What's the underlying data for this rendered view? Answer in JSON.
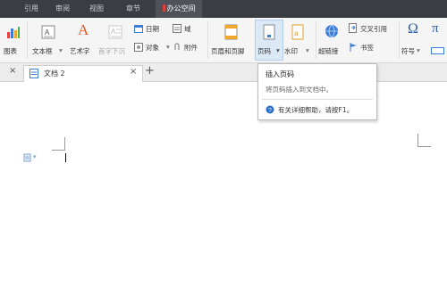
{
  "menubar": {
    "items": [
      {
        "label": "引用"
      },
      {
        "label": "审阅"
      },
      {
        "label": "视图"
      },
      {
        "label": "章节"
      },
      {
        "label": "办公空间"
      }
    ]
  },
  "ribbon": {
    "chart_label": "图表",
    "textbox_label": "文本框",
    "wordart_label": "艺术字",
    "dropcap_label": "首字下沉",
    "date_label": "日期",
    "field_label": "域",
    "object_label": "对象",
    "attachment_label": "附件",
    "header_footer_label": "页眉和页脚",
    "page_number_label": "页码",
    "watermark_label": "水印",
    "hyperlink_label": "超链接",
    "cross_ref_label": "交叉引用",
    "bookmark_label": "书签",
    "symbol_label": "符号",
    "dropdown_arrow": "▾",
    "pi_glyph": "π"
  },
  "tabbar": {
    "close_glyph": "×",
    "doc_tab_label": "文档 2",
    "tab_close_glyph": "×",
    "new_tab_glyph": "+"
  },
  "tooltip": {
    "title": "插入页码",
    "description": "将页码插入到文档中。",
    "help_text": "有关详细帮助，请按F1。"
  },
  "colors": {
    "menubar_bg": "#3a3d42",
    "ribbon_bg": "#f5f5f5",
    "selected_button_bg": "#dbe8f6",
    "help_icon": "#2a6fc9"
  }
}
